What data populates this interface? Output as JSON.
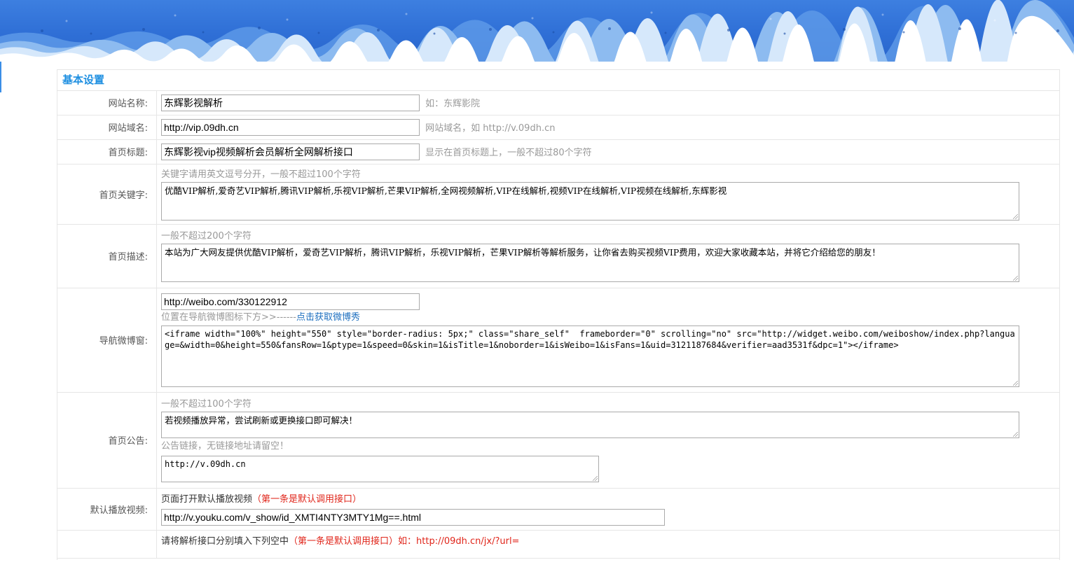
{
  "section_title": "基本设置",
  "fields": {
    "site_name": {
      "label": "网站名称:",
      "value": "东辉影视解析",
      "hint": "如：东辉影院"
    },
    "site_domain": {
      "label": "网站域名:",
      "value": "http://vip.09dh.cn",
      "hint": "网站域名，如 http://v.09dh.cn"
    },
    "home_title": {
      "label": "首页标题:",
      "value": "东辉影视vip视频解析会员解析全网解析接口",
      "hint": "显示在首页标题上，一般不超过80个字符"
    },
    "home_keywords": {
      "label": "首页关键字:",
      "hint": "关键字请用英文逗号分开，一般不超过100个字符",
      "value": "优酷VIP解析,爱奇艺VIP解析,腾讯VIP解析,乐视VIP解析,芒果VIP解析,全网视频解析,VIP在线解析,视频VIP在线解析,VIP视频在线解析,东辉影视"
    },
    "home_description": {
      "label": "首页描述:",
      "hint": "一般不超过200个字符",
      "value": "本站为广大网友提供优酷VIP解析，爱奇艺VIP解析，腾讯VIP解析，乐视VIP解析，芒果VIP解析等解析服务，让你省去购买视频VIP费用，欢迎大家收藏本站，并将它介绍给您的朋友！"
    },
    "nav_weibo": {
      "label": "导航微博窗:",
      "url_value": "http://weibo.com/330122912",
      "hint": "位置在导航微博图标下方>>------",
      "link_text": "点击获取微博秀",
      "code_value": "<iframe width=\"100%\" height=\"550\" style=\"border-radius: 5px;\" class=\"share_self\"  frameborder=\"0\" scrolling=\"no\" src=\"http://widget.weibo.com/weiboshow/index.php?language=&width=0&height=550&fansRow=1&ptype=1&speed=0&skin=1&isTitle=1&noborder=1&isWeibo=1&isFans=1&uid=3121187684&verifier=aad3531f&dpc=1\"></iframe>"
    },
    "home_notice": {
      "label": "首页公告:",
      "hint": "一般不超过100个字符",
      "value": "若视频播放异常，尝试刷新或更换接口即可解决！",
      "link_hint": "公告链接，无链接地址请留空！",
      "link_value": "http://v.09dh.cn"
    },
    "default_video": {
      "label": "默认播放视频:",
      "hint": "页面打开默认播放视频",
      "hint_red": "（第一条是默认调用接口）",
      "value": "http://v.youku.com/v_show/id_XMTI4NTY3MTY1Mg==.html"
    },
    "parse_api": {
      "hint": "请将解析接口分别填入下列空中",
      "hint_red": "（第一条是默认调用接口）如：http://09dh.cn/jx/?url="
    }
  }
}
